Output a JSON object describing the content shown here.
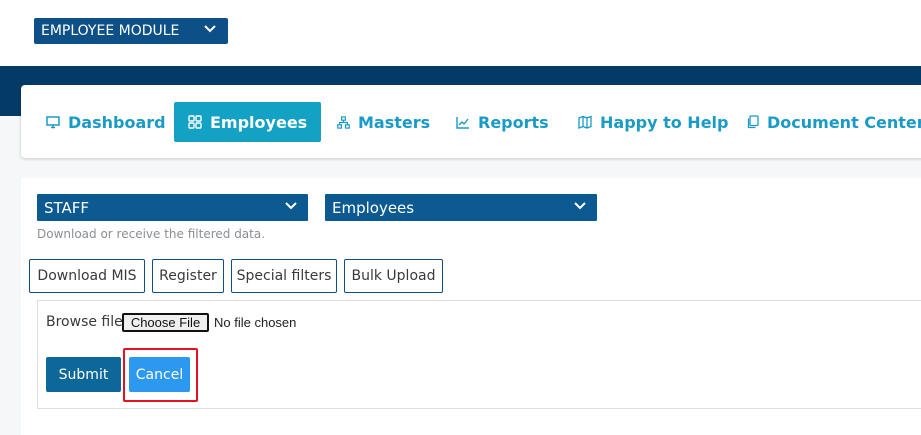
{
  "module_selector": {
    "label": "EMPLOYEE MODULE",
    "icon": "chevron-down-icon"
  },
  "nav": {
    "items": [
      {
        "label": "Dashboard",
        "icon": "monitor-icon",
        "active": false
      },
      {
        "label": "Employees",
        "icon": "grid-icon",
        "active": true
      },
      {
        "label": "Masters",
        "icon": "hierarchy-icon",
        "active": false
      },
      {
        "label": "Reports",
        "icon": "chart-line-icon",
        "active": false
      },
      {
        "label": "Happy to Help",
        "icon": "map-icon",
        "active": false
      },
      {
        "label": "Document Center",
        "icon": "documents-icon",
        "active": false
      }
    ]
  },
  "filters": {
    "category": {
      "value": "STAFF"
    },
    "entity": {
      "value": "Employees"
    },
    "hint": "Download or receive the filtered data."
  },
  "actions": {
    "download_mis": "Download MIS",
    "register": "Register",
    "special_filters": "Special filters",
    "bulk_upload": "Bulk Upload"
  },
  "upload": {
    "label": "Browse file",
    "choose_button": "Choose File",
    "status": "No file chosen",
    "submit": "Submit",
    "cancel": "Cancel"
  },
  "colors": {
    "brand_navy": "#033b66",
    "dropdown_blue": "#0d5a93",
    "nav_accent": "#1a9bc7",
    "active_tab": "#13a2c4",
    "submit": "#0c6898",
    "cancel": "#2d98f0",
    "highlight": "#e3141f"
  }
}
